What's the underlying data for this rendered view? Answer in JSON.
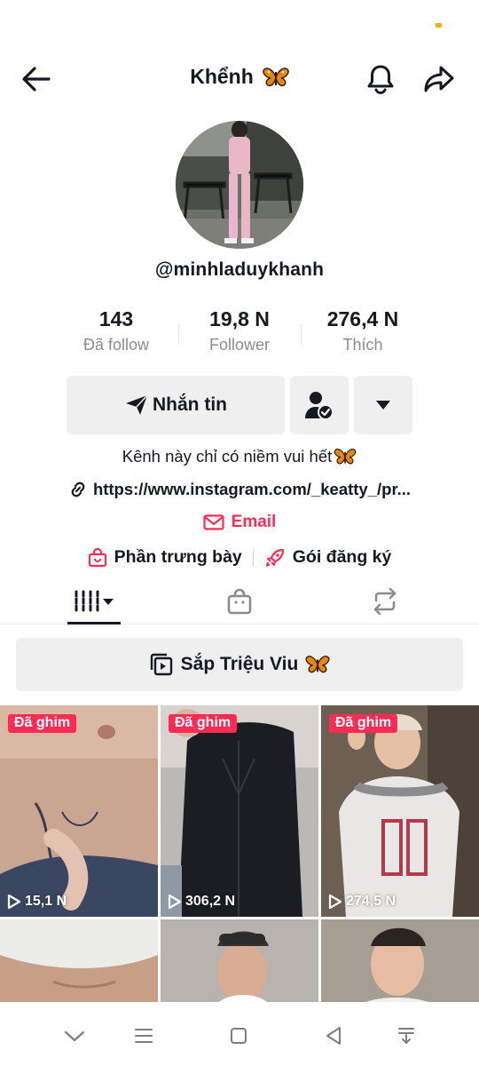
{
  "header": {
    "title": "Khểnh"
  },
  "profile": {
    "username": "@minhladuykhanh"
  },
  "stats": [
    {
      "value": "143",
      "label": "Đã follow"
    },
    {
      "value": "19,8 N",
      "label": "Follower"
    },
    {
      "value": "276,4 N",
      "label": "Thích"
    }
  ],
  "actions": {
    "message_label": "Nhắn tin"
  },
  "bio": {
    "text": "Kênh này chỉ có niềm vui hết",
    "link": "https://www.instagram.com/_keatty_/pr...",
    "email_label": "Email"
  },
  "shop": {
    "showcase_label": "Phần trưng bày",
    "subscription_label": "Gói đăng ký"
  },
  "playlist": {
    "label": "Sắp Triệu Viu"
  },
  "videos": [
    {
      "pinned_label": "Đã ghim",
      "views": "15,1 N"
    },
    {
      "pinned_label": "Đã ghim",
      "views": "306,2 N"
    },
    {
      "pinned_label": "Đã ghim",
      "views": "274,5 N"
    }
  ],
  "colors": {
    "accent": "#fe2c55",
    "text": "#161823",
    "muted": "#8a8b91",
    "button_bg": "#efeff0"
  }
}
